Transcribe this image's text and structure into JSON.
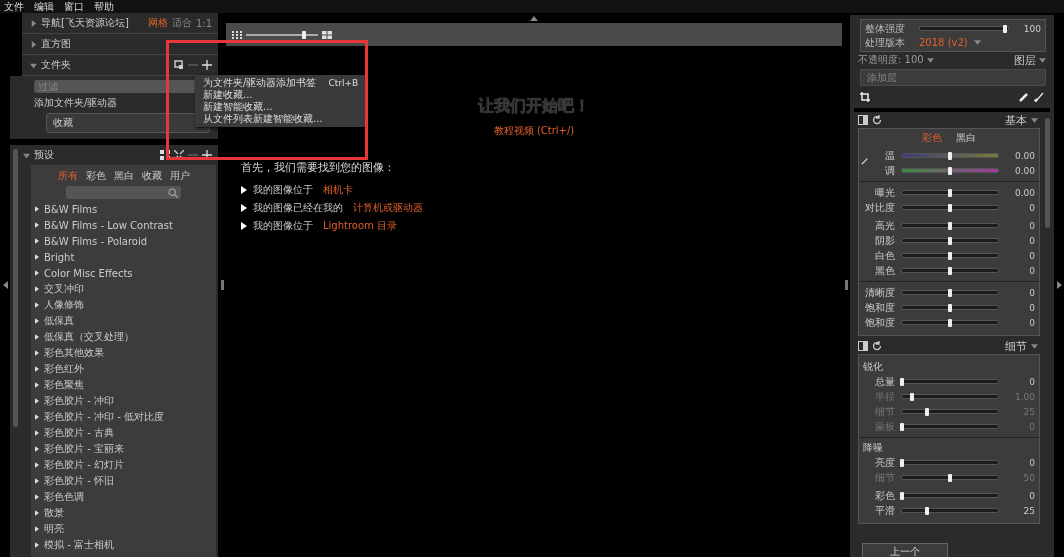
{
  "menubar": [
    "文件",
    "编辑",
    "窗口",
    "帮助"
  ],
  "left_panel": {
    "navigator": {
      "title": "导航[飞天资源论坛]",
      "expanded": false,
      "zoom_options": [
        {
          "label": "网格",
          "selected": true
        },
        {
          "label": "适合",
          "selected": false
        },
        {
          "label": "1:1",
          "selected": false
        }
      ]
    },
    "histogram": {
      "title": "直方图",
      "expanded": false
    },
    "folders": {
      "title": "文件夹",
      "expanded": true,
      "filter": {
        "placeholder": "过滤"
      },
      "add_label": "添加文件夹/驱动器",
      "collection": {
        "value": "收藏"
      }
    },
    "presets": {
      "title": "预设",
      "expanded": true,
      "tabs": [
        {
          "label": "所有",
          "selected": true
        },
        {
          "label": "彩色",
          "selected": false
        },
        {
          "label": "黑白",
          "selected": false
        },
        {
          "label": "收藏",
          "selected": false
        },
        {
          "label": "用户",
          "selected": false
        }
      ],
      "items": [
        "B&W Films",
        "B&W Films - Low Contrast",
        "B&W Films - Polaroid",
        "Bright",
        "Color Misc Effects",
        "交叉冲印",
        "人像修饰",
        "低保真",
        "低保真（交叉处理）",
        "彩色其他效果",
        "彩色红外",
        "彩色聚焦",
        "彩色胶片 - 冲印",
        "彩色胶片 - 冲印 - 低对比度",
        "彩色胶片 - 古典",
        "彩色胶片 - 宝丽来",
        "彩色胶片 - 幻灯片",
        "彩色胶片 - 怀旧",
        "彩色色调",
        "散景",
        "明亮",
        "模拟 - 富士相机"
      ]
    }
  },
  "context_menu": {
    "items": [
      {
        "label": "为文件夹/驱动器添加书签",
        "shortcut": "Ctrl+B"
      },
      {
        "label": "新建收藏..."
      },
      {
        "label": "新建智能收藏..."
      },
      {
        "label": "从文件列表新建智能收藏..."
      }
    ]
  },
  "center": {
    "thumbnail_size": {
      "level": 0.8
    },
    "title": "让我们开始吧！",
    "tutorial_link": "教程视频 (Ctrl+/)",
    "prompt": "首先，我们需要找到您的图像：",
    "options": [
      {
        "text": "我的图像位于",
        "link": "相机卡"
      },
      {
        "text": "我的图像已经在我的",
        "link": "计算机或驱动器"
      },
      {
        "text": "我的图像位于",
        "link": "Lightroom 目录"
      }
    ]
  },
  "right_panel": {
    "intensity": {
      "label": "整体强度",
      "value": "100",
      "level": 0.97
    },
    "process_version": {
      "label": "处理版本",
      "value": "2018 (v2)"
    },
    "opacity": "不透明度: 100",
    "layers": {
      "title": "图层",
      "add_layer": {
        "placeholder": "添加层"
      }
    },
    "basic": {
      "title": "基本",
      "tabs": [
        {
          "label": "彩色",
          "selected": true
        },
        {
          "label": "黑白",
          "selected": false
        }
      ],
      "groups": [
        {
          "rule": false,
          "eyedropper": true,
          "sliders": [
            {
              "label": "温",
              "value": "0.00",
              "level": 0.5,
              "kind": "temperature",
              "disabled": false
            },
            {
              "label": "调",
              "value": "0.00",
              "level": 0.5,
              "kind": "tint",
              "disabled": false
            }
          ]
        },
        {
          "rule": true,
          "sliders": [
            {
              "label": "曝光",
              "value": "0.00",
              "level": 0.5,
              "kind": "plain",
              "disabled": false
            },
            {
              "label": "对比度",
              "value": "0",
              "level": 0.5,
              "kind": "plain",
              "disabled": false
            }
          ]
        },
        {
          "rule": false,
          "sliders": [
            {
              "label": "高光",
              "value": "0",
              "level": 0.5,
              "kind": "plain",
              "disabled": false
            },
            {
              "label": "阴影",
              "value": "0",
              "level": 0.5,
              "kind": "plain",
              "disabled": false
            },
            {
              "label": "白色",
              "value": "0",
              "level": 0.5,
              "kind": "plain",
              "disabled": false
            },
            {
              "label": "黑色",
              "value": "0",
              "level": 0.5,
              "kind": "plain",
              "disabled": false
            }
          ]
        },
        {
          "rule": true,
          "sliders": [
            {
              "label": "清晰度",
              "value": "0",
              "level": 0.5,
              "kind": "plain",
              "disabled": false
            },
            {
              "label": "饱和度",
              "value": "0",
              "level": 0.5,
              "kind": "plain",
              "disabled": false
            },
            {
              "label": "饱和度",
              "value": "0",
              "level": 0.5,
              "kind": "plain",
              "disabled": false
            }
          ]
        }
      ]
    },
    "detail": {
      "title": "细节",
      "groups": [
        {
          "title": "锐化",
          "rule": false,
          "sliders": [
            {
              "label": "总量",
              "value": "0",
              "level": 0,
              "kind": "plain",
              "disabled": false
            },
            {
              "label": "半径",
              "value": "1.00",
              "level": 0.1,
              "kind": "plain",
              "disabled": true
            },
            {
              "label": "细节",
              "value": "25",
              "level": 0.26,
              "kind": "plain",
              "disabled": true
            },
            {
              "label": "蒙板",
              "value": "0",
              "level": 0,
              "kind": "plain",
              "disabled": true
            }
          ]
        },
        {
          "title": "降噪",
          "rule": true,
          "sliders": [
            {
              "label": "亮度",
              "value": "0",
              "level": 0,
              "kind": "plain",
              "disabled": false
            },
            {
              "label": "细节",
              "value": "50",
              "level": 0.5,
              "kind": "plain",
              "disabled": true
            }
          ]
        },
        {
          "rule": false,
          "sliders": [
            {
              "label": "彩色",
              "value": "0",
              "level": 0,
              "kind": "plain",
              "disabled": false
            },
            {
              "label": "平滑",
              "value": "25",
              "level": 0.26,
              "kind": "plain",
              "disabled": false
            }
          ]
        }
      ]
    },
    "buttons": [
      "上一个"
    ]
  }
}
